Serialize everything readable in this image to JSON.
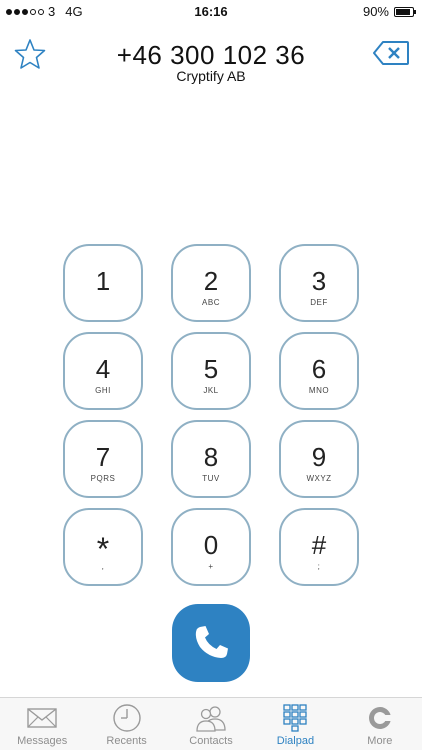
{
  "status_bar": {
    "signal_dots_filled": 3,
    "signal_dots_total": 5,
    "carrier": "3",
    "network": "4G",
    "time": "16:16",
    "battery_percent": "90%",
    "battery_level": 0.9
  },
  "header": {
    "phone_number": "+46 300 102 36",
    "contact_name": "Cryptify AB",
    "favorite_icon": "star-outline-icon",
    "backspace_icon": "backspace-icon"
  },
  "keypad": {
    "keys": [
      {
        "digit": "1",
        "letters": ""
      },
      {
        "digit": "2",
        "letters": "ABC"
      },
      {
        "digit": "3",
        "letters": "DEF"
      },
      {
        "digit": "4",
        "letters": "GHI"
      },
      {
        "digit": "5",
        "letters": "JKL"
      },
      {
        "digit": "6",
        "letters": "MNO"
      },
      {
        "digit": "7",
        "letters": "PQRS"
      },
      {
        "digit": "8",
        "letters": "TUV"
      },
      {
        "digit": "9",
        "letters": "WXYZ"
      },
      {
        "digit": "*",
        "letters": ","
      },
      {
        "digit": "0",
        "letters": "+"
      },
      {
        "digit": "#",
        "letters": ";"
      }
    ]
  },
  "call_button": {
    "icon": "phone-icon"
  },
  "colors": {
    "accent": "#2e82c2",
    "key_border": "#8fb0c4",
    "tab_inactive": "#8e8e8e"
  },
  "tabs": [
    {
      "label": "Messages",
      "icon": "messages-icon",
      "active": false
    },
    {
      "label": "Recents",
      "icon": "clock-icon",
      "active": false
    },
    {
      "label": "Contacts",
      "icon": "contacts-icon",
      "active": false
    },
    {
      "label": "Dialpad",
      "icon": "dialpad-icon",
      "active": true
    },
    {
      "label": "More",
      "icon": "more-icon",
      "active": false
    }
  ]
}
